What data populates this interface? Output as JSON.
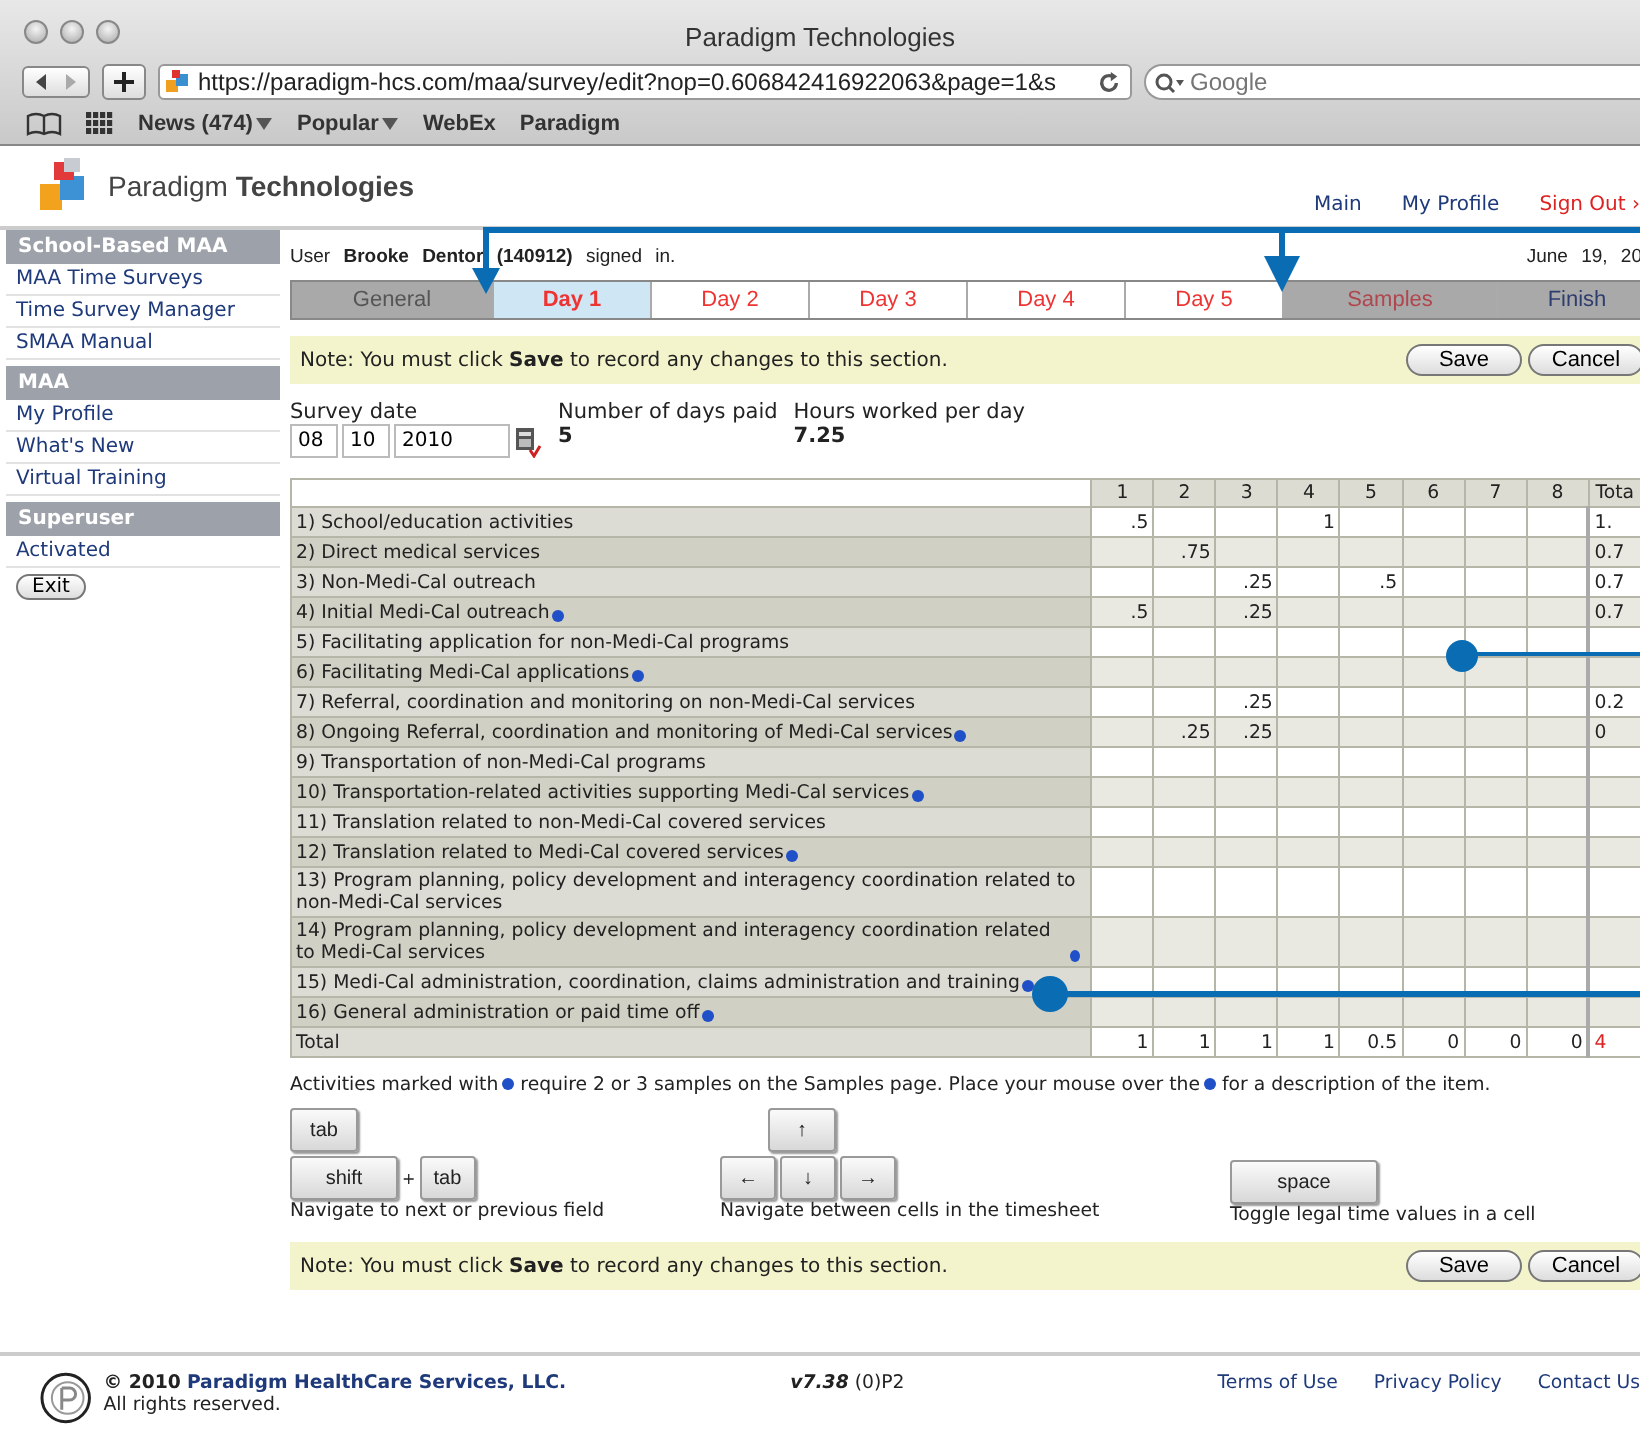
{
  "browser": {
    "title": "Paradigm Technologies",
    "url": "https://paradigm-hcs.com/maa/survey/edit?nop=0.606842416922063&page=1&s",
    "search_placeholder": "Google",
    "bookmarks": [
      {
        "label": "News (474)",
        "menu": true
      },
      {
        "label": "Popular",
        "menu": true
      },
      {
        "label": "WebEx",
        "menu": false
      },
      {
        "label": "Paradigm",
        "menu": false
      }
    ]
  },
  "header": {
    "brand_light": "Paradigm",
    "brand_bold": "Technologies",
    "links": [
      {
        "label": "Main",
        "kind": "nav"
      },
      {
        "label": "My Profile",
        "kind": "nav"
      },
      {
        "label": "Sign Out ›",
        "kind": "signout"
      }
    ]
  },
  "sidebar": [
    {
      "title": "School-Based MAA",
      "items": [
        {
          "label": "MAA Time Surveys",
          "kind": "link"
        },
        {
          "label": "Time Survey Manager",
          "kind": "link"
        },
        {
          "label": "SMAA Manual",
          "kind": "link"
        }
      ]
    },
    {
      "title": "MAA",
      "items": [
        {
          "label": "My Profile",
          "kind": "link"
        },
        {
          "label": "What's New",
          "kind": "link"
        },
        {
          "label": "Virtual Training",
          "kind": "link"
        }
      ]
    },
    {
      "title": "Superuser",
      "items": [
        {
          "label": "Activated",
          "kind": "link"
        },
        {
          "label": "Exit",
          "kind": "button"
        }
      ]
    }
  ],
  "user_line": "User **Brooke Dentor (140912)** signed in.",
  "date": "June 19, 20",
  "tabs": [
    {
      "label": "General",
      "kind": "general",
      "selected": false
    },
    {
      "label": "Day 1",
      "kind": "day",
      "selected": true
    },
    {
      "label": "Day 2",
      "kind": "day",
      "selected": false
    },
    {
      "label": "Day 3",
      "kind": "day",
      "selected": false
    },
    {
      "label": "Day 4",
      "kind": "day",
      "selected": false
    },
    {
      "label": "Day 5",
      "kind": "day",
      "selected": false
    },
    {
      "label": "Samples",
      "kind": "samples",
      "selected": false
    },
    {
      "label": "Finish",
      "kind": "finish",
      "selected": false
    }
  ],
  "note_top": {
    "text": "Note: You must click **Save** to record any changes to this section.",
    "buttons": [
      "Save",
      "Cancel"
    ]
  },
  "survey": {
    "date_label": "Survey date",
    "month": "08",
    "day": "10",
    "year": "2010",
    "days_paid_label": "Number of days paid",
    "days_paid": "5",
    "hours_label": "Hours worked per day",
    "hours": "7.25"
  },
  "table": {
    "columns": [
      "1",
      "2",
      "3",
      "4",
      "5",
      "6",
      "7",
      "8",
      "Tota"
    ],
    "rows": [
      {
        "label": "1) School/education activities",
        "marked": false,
        "cells": [
          ".5",
          null,
          null,
          "1",
          null,
          null,
          null,
          null
        ],
        "total": "1."
      },
      {
        "label": "2) Direct medical services",
        "marked": false,
        "cells": [
          null,
          ".75",
          null,
          null,
          null,
          null,
          null,
          null
        ],
        "total": "0.7"
      },
      {
        "label": "3) Non-Medi-Cal outreach",
        "marked": false,
        "cells": [
          null,
          null,
          ".25",
          null,
          ".5",
          null,
          null,
          null
        ],
        "total": "0.7"
      },
      {
        "label": "4) Initial Medi-Cal outreach",
        "marked": true,
        "cells": [
          ".5",
          null,
          ".25",
          null,
          null,
          null,
          null,
          null
        ],
        "total": "0.7"
      },
      {
        "label": "5) Facilitating application for non-Medi-Cal programs",
        "marked": false,
        "cells": [
          null,
          null,
          null,
          null,
          null,
          null,
          null,
          null
        ]
      },
      {
        "label": "6) Facilitating Medi-Cal applications",
        "marked": true,
        "cells": [
          null,
          null,
          null,
          null,
          null,
          null,
          null,
          null
        ]
      },
      {
        "label": "7) Referral, coordination and monitoring on non-Medi-Cal services",
        "marked": false,
        "cells": [
          null,
          null,
          ".25",
          null,
          null,
          null,
          null,
          null
        ],
        "total": "0.2"
      },
      {
        "label": "8) Ongoing Referral, coordination and monitoring of Medi-Cal services",
        "marked": true,
        "cells": [
          null,
          ".25",
          ".25",
          null,
          null,
          null,
          null,
          null
        ],
        "total": "0"
      },
      {
        "label": "9) Transportation of non-Medi-Cal programs",
        "marked": false,
        "cells": [
          null,
          null,
          null,
          null,
          null,
          null,
          null,
          null
        ]
      },
      {
        "label": "10) Transportation-related activities supporting Medi-Cal services",
        "marked": true,
        "cells": [
          null,
          null,
          null,
          null,
          null,
          null,
          null,
          null
        ]
      },
      {
        "label": "11) Translation related to non-Medi-Cal covered services",
        "marked": false,
        "cells": [
          null,
          null,
          null,
          null,
          null,
          null,
          null,
          null
        ]
      },
      {
        "label": "12) Translation related to Medi-Cal covered services",
        "marked": true,
        "cells": [
          null,
          null,
          null,
          null,
          null,
          null,
          null,
          null
        ]
      },
      {
        "label": "13) Program planning, policy development and interagency coordination related to non-Medi-Cal services",
        "marked": false,
        "cells": [
          null,
          null,
          null,
          null,
          null,
          null,
          null,
          null
        ]
      },
      {
        "label": "14) Program planning, policy development and interagency coordination related to Medi-Cal services",
        "marked": true,
        "cells": [
          null,
          null,
          null,
          null,
          null,
          null,
          null,
          null
        ]
      },
      {
        "label": "15) Medi-Cal administration, coordination, claims administration and training",
        "marked": true,
        "cells": [
          null,
          null,
          null,
          null,
          null,
          null,
          null,
          null
        ]
      },
      {
        "label": "16) General administration or paid time off",
        "marked": true,
        "cells": [
          null,
          null,
          null,
          null,
          null,
          null,
          null,
          null
        ]
      }
    ],
    "total_row": {
      "label": "Total",
      "cells": [
        "1",
        "1",
        "1",
        "1",
        "0.5",
        "0",
        "0",
        "0"
      ],
      "total": "4"
    }
  },
  "legend": [
    "Activities marked with",
    "require 2 or 3 samples on the Samples page. Place your mouse over the",
    "for a description of the item."
  ],
  "shortcuts": [
    {
      "rows": [
        [
          {
            "label": "tab",
            "kind": "key"
          }
        ],
        [
          {
            "label": "shift",
            "kind": "key"
          },
          {
            "label": "+",
            "kind": "plus"
          },
          {
            "label": "tab",
            "kind": "key"
          }
        ]
      ],
      "caption": "Navigate to next or previous field"
    },
    {
      "rows": [
        [
          {
            "label": "↑",
            "kind": "key"
          }
        ],
        [
          {
            "label": "←",
            "kind": "key"
          },
          {
            "label": "↓",
            "kind": "key"
          },
          {
            "label": "→",
            "kind": "key"
          }
        ]
      ],
      "caption": "Navigate between cells in the timesheet"
    },
    {
      "rows": [
        [
          {
            "label": "space",
            "kind": "wide"
          }
        ]
      ],
      "caption": "Toggle legal time values in a cell"
    }
  ],
  "note_bottom": {
    "text": "Note: You must click **Save** to record any changes to this section.",
    "buttons": [
      "Save",
      "Cancel"
    ]
  },
  "footer": {
    "copyright": "© 2010",
    "company": "Paradigm HealthCare Services, LLC.",
    "rights": "All rights reserved.",
    "version": "v7.38",
    "build": "(0)P2",
    "links": [
      "Terms of Use",
      "Privacy Policy",
      "Contact Us"
    ]
  }
}
